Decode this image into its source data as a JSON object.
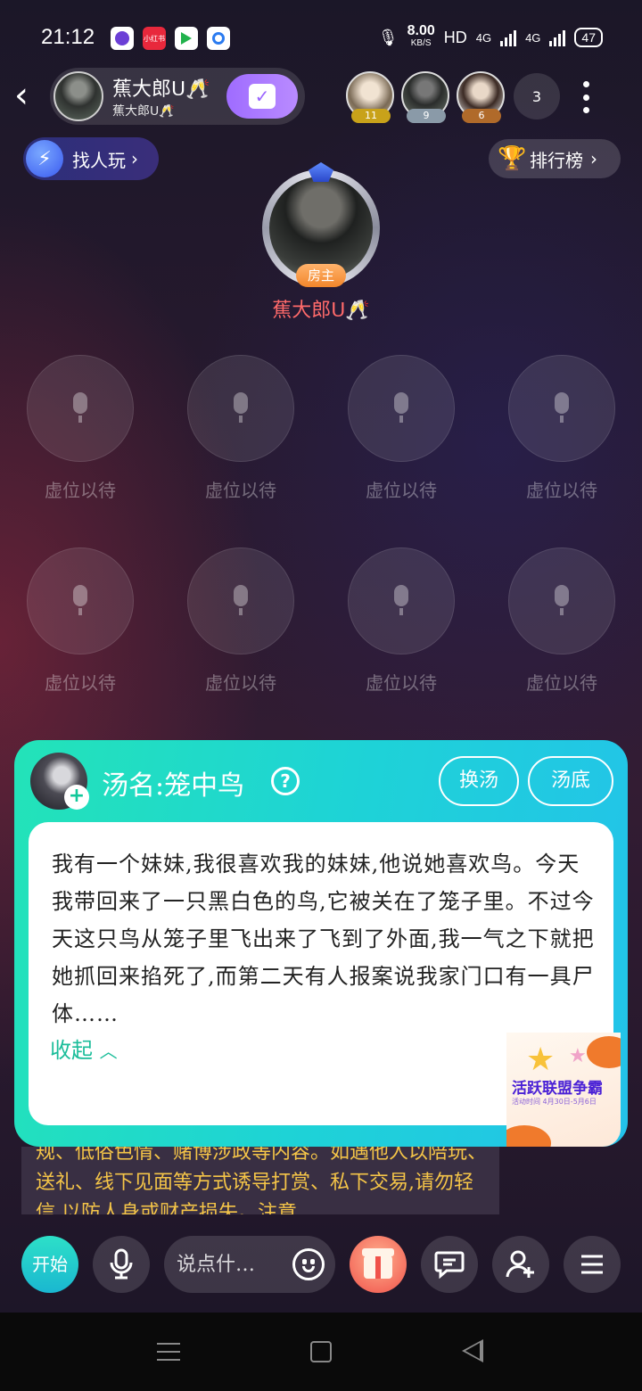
{
  "status_bar": {
    "time": "21:12",
    "app_icons": [
      "app-icon-purple",
      "app-icon-xiaohongshu",
      "app-icon-video",
      "app-icon-blue"
    ],
    "xhs_label": "小红书",
    "net_speed_value": "8.00",
    "net_speed_unit": "KB/S",
    "hd_label": "HD",
    "net1": "4G",
    "net2": "4G",
    "battery": "47"
  },
  "header": {
    "host_name": "蕉大郎ᑌ🥂",
    "host_sub": "蕉大郎ᑌ🥂",
    "audience": [
      {
        "level": "11",
        "badge_color": "#c8a21a"
      },
      {
        "level": "9",
        "badge_color": "#8a9aa8"
      },
      {
        "level": "6",
        "badge_color": "#b06a2a"
      }
    ],
    "audience_count": "3"
  },
  "quick": {
    "find_play": "找人玩",
    "ranking": "排行榜"
  },
  "owner_seat": {
    "tag": "房主",
    "name": "蕉大郎ᑌ🥂"
  },
  "seats": [
    {
      "label": "虚位以待"
    },
    {
      "label": "虚位以待"
    },
    {
      "label": "虚位以待"
    },
    {
      "label": "虚位以待"
    },
    {
      "label": "虚位以待"
    },
    {
      "label": "虚位以待"
    },
    {
      "label": "虚位以待"
    },
    {
      "label": "虚位以待"
    }
  ],
  "soup_card": {
    "title": "汤名:笼中鸟",
    "change_soup": "换汤",
    "soup_answer": "汤底",
    "story": "我有一个妹妹,我很喜欢我的妹妹,他说她喜欢鸟。今天我带回来了一只黑白色的鸟,它被关在了笼子里。不过今天这只鸟从笼子里飞出来了飞到了外面,我一气之下就把她抓回来掐死了,而第二天有人报案说我家门口有一具尸体……",
    "collapse": "收起",
    "promo_title": "活跃联盟争霸",
    "promo_date": "活动时间 4月30日-5月6日"
  },
  "rules_text": "规、低俗色情、赌博涉政等内容。如遇他人以陪玩、送礼、线下见面等方式诱导打赏、私下交易,请勿轻信,以防人身或财产损失。注意",
  "toolbar": {
    "start": "开始",
    "chat_placeholder": "说点什…"
  },
  "colors": {
    "card_gradient_start": "#23e3b8",
    "card_gradient_end": "#23c2ea",
    "rules_text": "#f5c548",
    "owner_name": "#ff6a6a"
  }
}
